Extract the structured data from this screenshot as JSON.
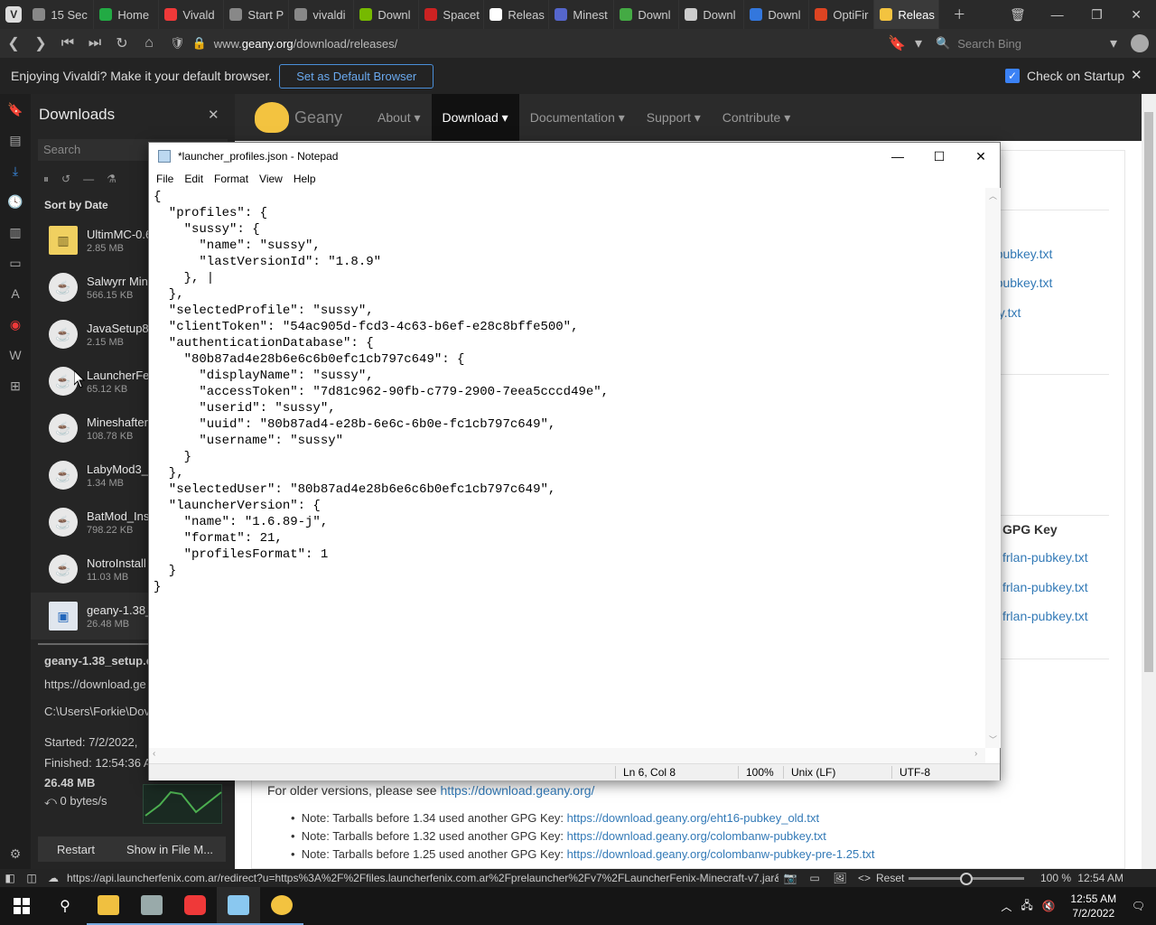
{
  "browser": {
    "tabs": [
      {
        "label": "15 Sec",
        "color": "#888888"
      },
      {
        "label": "Home",
        "color": "#22aa44"
      },
      {
        "label": "Vivald",
        "color": "#ef3939"
      },
      {
        "label": "Start P",
        "color": "#888888"
      },
      {
        "label": "vivaldi",
        "color": "#888888"
      },
      {
        "label": "Downl",
        "color": "#76b900"
      },
      {
        "label": "Spacet",
        "color": "#cc2222"
      },
      {
        "label": "Releas",
        "color": "#ffffff"
      },
      {
        "label": "Minest",
        "color": "#5566cc"
      },
      {
        "label": "Downl",
        "color": "#44aa44"
      },
      {
        "label": "Downl",
        "color": "#cccccc"
      },
      {
        "label": "Downl",
        "color": "#3377dd"
      },
      {
        "label": "OptiFir",
        "color": "#dd4422"
      },
      {
        "label": "Releas",
        "color": "#f3c340"
      }
    ],
    "url_prefix": "www.",
    "url_host": "geany.org",
    "url_path": "/download/releases/",
    "search_placeholder": "Search Bing"
  },
  "notification": {
    "text": "Enjoying Vivaldi? Make it your default browser.",
    "button": "Set as Default Browser",
    "checkbox_label": "Check on Startup"
  },
  "downloads": {
    "title": "Downloads",
    "search_placeholder": "Search",
    "sort_label": "Sort by Date",
    "items": [
      {
        "name": "UltimMC-0.6",
        "size": "2.85 MB",
        "type": "zip"
      },
      {
        "name": "Salwyrr Min",
        "size": "566.15 KB",
        "type": "java"
      },
      {
        "name": "JavaSetup8u",
        "size": "2.15 MB",
        "type": "java"
      },
      {
        "name": "LauncherFen",
        "size": "65.12 KB",
        "type": "java"
      },
      {
        "name": "Mineshafter",
        "size": "108.78 KB",
        "type": "java"
      },
      {
        "name": "LabyMod3_",
        "size": "1.34 MB",
        "type": "java"
      },
      {
        "name": "BatMod_Ins",
        "size": "798.22 KB",
        "type": "java"
      },
      {
        "name": "NotroInstall",
        "size": "11.03 MB",
        "type": "java"
      },
      {
        "name": "geany-1.38_",
        "size": "26.48 MB",
        "type": "exe"
      }
    ],
    "detail": {
      "filename": "geany-1.38_setup.e",
      "url": "https://download.ge",
      "path": "C:\\Users\\Forkie\\Dov",
      "started": "Started:  7/2/2022,",
      "finished": "Finished:  12:54:36 A",
      "total": "26.48 MB",
      "speed": "0 bytes/s"
    },
    "restart_button": "Restart",
    "show_button": "Show in File M..."
  },
  "site": {
    "brand": "Geany",
    "nav": [
      "About ▾",
      "Download ▾",
      "Documentation ▾",
      "Support ▾",
      "Contribute ▾"
    ],
    "links_top": [
      "-pubkey.txt",
      "-pubkey.txt",
      "ey.txt"
    ],
    "gpg_header": "GPG Key",
    "links_bottom": [
      "frlan-pubkey.txt",
      "frlan-pubkey.txt",
      "frlan-pubkey.txt"
    ],
    "older_text": "For older versions, please see ",
    "older_link": "https://download.geany.org/",
    "notes": [
      {
        "text": "Note: Tarballs before 1.34 used another GPG Key: ",
        "link": "https://download.geany.org/eht16-pubkey_old.txt"
      },
      {
        "text": "Note: Tarballs before 1.32 used another GPG Key: ",
        "link": "https://download.geany.org/colombanw-pubkey.txt"
      },
      {
        "text": "Note: Tarballs before 1.25 used another GPG Key: ",
        "link": "https://download.geany.org/colombanw-pubkey-pre-1.25.txt"
      }
    ]
  },
  "notepad": {
    "title": "*launcher_profiles.json - Notepad",
    "menu": [
      "File",
      "Edit",
      "Format",
      "View",
      "Help"
    ],
    "content": "{\n  \"profiles\": {\n    \"sussy\": {\n      \"name\": \"sussy\",\n      \"lastVersionId\": \"1.8.9\"\n    }, |\n  },\n  \"selectedProfile\": \"sussy\",\n  \"clientToken\": \"54ac905d-fcd3-4c63-b6ef-e28c8bffe500\",\n  \"authenticationDatabase\": {\n    \"80b87ad4e28b6e6c6b0efc1cb797c649\": {\n      \"displayName\": \"sussy\",\n      \"accessToken\": \"7d81c962-90fb-c779-2900-7eea5cccd49e\",\n      \"userid\": \"sussy\",\n      \"uuid\": \"80b87ad4-e28b-6e6c-6b0e-fc1cb797c649\",\n      \"username\": \"sussy\"\n    }\n  },\n  \"selectedUser\": \"80b87ad4e28b6e6c6b0efc1cb797c649\",\n  \"launcherVersion\": {\n    \"name\": \"1.6.89-j\",\n    \"format\": 21,\n    \"profilesFormat\": 1\n  }\n}",
    "status": {
      "position": "Ln 6, Col 8",
      "zoom": "100%",
      "eol": "Unix (LF)",
      "encoding": "UTF-8"
    }
  },
  "statusbar": {
    "link": "https://api.launcherfenix.com.ar/redirect?u=https%3A%2F%2Ffiles.launcherfenix.com.ar%2Fprelauncher%2Fv7%2FLauncherFenix-Minecraft-v7.jar&c8n=P...",
    "reset": "Reset",
    "zoom": "100 %",
    "time": "12:54 AM",
    "zoom_level": 0.5
  },
  "taskbar": {
    "time": "12:55 AM",
    "date": "7/2/2022"
  }
}
